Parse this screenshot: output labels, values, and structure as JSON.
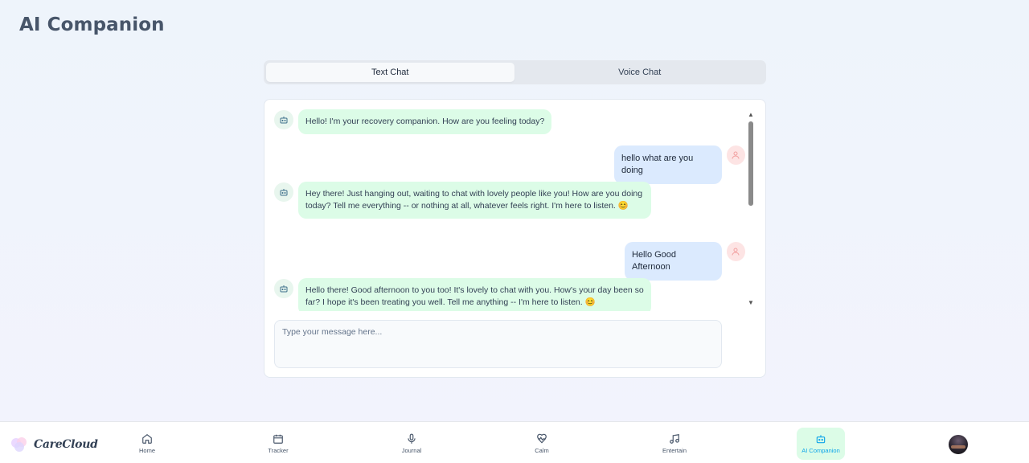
{
  "page": {
    "title": "AI Companion"
  },
  "tabs": [
    {
      "label": "Text Chat",
      "active": true
    },
    {
      "label": "Voice Chat",
      "active": false
    }
  ],
  "messages": [
    {
      "role": "bot",
      "text": "Hello! I'm your recovery companion. How are you feeling today?"
    },
    {
      "role": "user",
      "text": "hello what are you doing"
    },
    {
      "role": "bot",
      "text": "Hey there! Just hanging out, waiting to chat with lovely people like you! How are you doing today? Tell me everything -- or nothing at all, whatever feels right. I'm here to listen. 😊"
    },
    {
      "role": "user",
      "text": "Hello Good Afternoon"
    },
    {
      "role": "bot",
      "text": "Hello there! Good afternoon to you too! It's lovely to chat with you. How's your day been so far? I hope it's been treating you well. Tell me anything -- I'm here to listen. 😊"
    }
  ],
  "input": {
    "placeholder": "Type your message here...",
    "value": ""
  },
  "scroll": {
    "position_fraction": 0.0
  },
  "nav": {
    "brand": "CareCloud",
    "items": [
      {
        "label": "Home",
        "icon": "home-icon",
        "active": false
      },
      {
        "label": "Tracker",
        "icon": "calendar-icon",
        "active": false
      },
      {
        "label": "Journal",
        "icon": "microphone-icon",
        "active": false
      },
      {
        "label": "Calm",
        "icon": "heart-pulse-icon",
        "active": false
      },
      {
        "label": "Entertain",
        "icon": "music-note-icon",
        "active": false
      },
      {
        "label": "AI Companion",
        "icon": "robot-icon",
        "active": true
      }
    ]
  },
  "colors": {
    "bot_bubble": "#dcfce7",
    "user_bubble": "#dbeafe",
    "active_nav": "#dcfce7",
    "active_nav_text": "#0ea5e9"
  }
}
